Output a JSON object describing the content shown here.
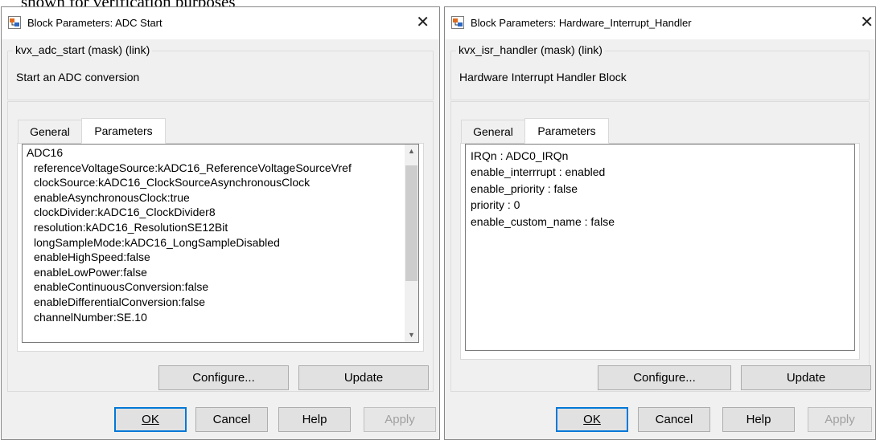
{
  "caption": "shown for verification purposes",
  "dialogs": [
    {
      "title": "Block Parameters: ADC Start",
      "mask_title": "kvx_adc_start (mask) (link)",
      "description": "Start an ADC conversion",
      "tabs": [
        "General",
        "Parameters"
      ],
      "active_tab": "Parameters",
      "parameters": [
        "ADC16",
        "referenceVoltageSource:kADC16_ReferenceVoltageSourceVref",
        "clockSource:kADC16_ClockSourceAsynchronousClock",
        "enableAsynchronousClock:true",
        "clockDivider:kADC16_ClockDivider8",
        "resolution:kADC16_ResolutionSE12Bit",
        "longSampleMode:kADC16_LongSampleDisabled",
        "enableHighSpeed:false",
        "enableLowPower:false",
        "enableContinuousConversion:false",
        "enableDifferentialConversion:false",
        "channelNumber:SE.10"
      ],
      "buttons": {
        "configure": "Configure...",
        "update": "Update",
        "ok": "OK",
        "cancel": "Cancel",
        "help": "Help",
        "apply": "Apply"
      }
    },
    {
      "title": "Block Parameters: Hardware_Interrupt_Handler",
      "mask_title": "kvx_isr_handler (mask) (link)",
      "description": "Hardware Interrupt Handler Block",
      "tabs": [
        "General",
        "Parameters"
      ],
      "active_tab": "Parameters",
      "parameters": [
        "IRQn : ADC0_IRQn",
        "enable_interrrupt : enabled",
        "enable_priority : false",
        "priority : 0",
        "enable_custom_name : false"
      ],
      "buttons": {
        "configure": "Configure...",
        "update": "Update",
        "ok": "OK",
        "cancel": "Cancel",
        "help": "Help",
        "apply": "Apply"
      }
    }
  ],
  "icons": {
    "app": "simulink-block-icon",
    "close": "close-icon",
    "scroll_up": "scroll-up-arrow-icon",
    "scroll_down": "scroll-down-arrow-icon"
  },
  "colors": {
    "ok_border": "#0078d7",
    "dialog_bg": "#f0f0f0"
  }
}
